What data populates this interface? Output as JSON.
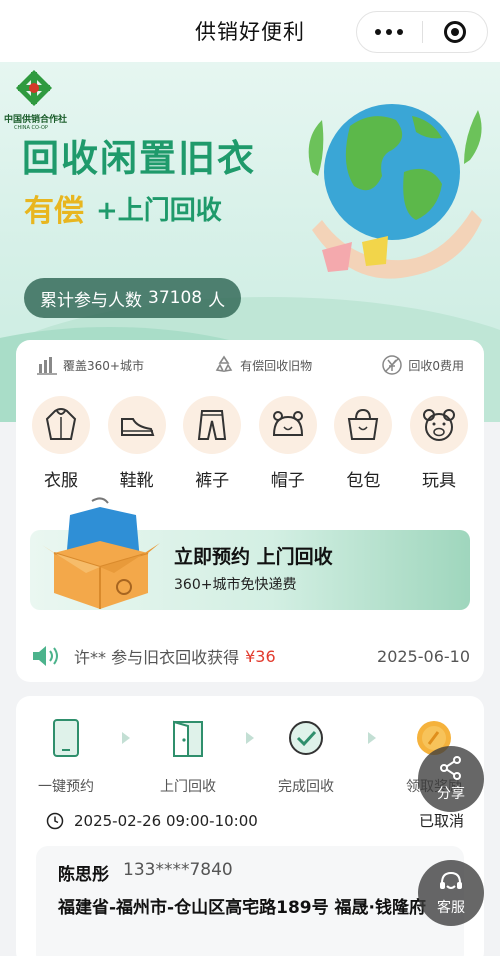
{
  "nav": {
    "title": "供销好便利"
  },
  "banner": {
    "logo_cn": "中国供销合作社",
    "logo_en": "CHINA CO-OP",
    "headline": "回收闲置旧衣",
    "paid": "有偿",
    "door": "+上门回收",
    "participants_label": "累计参与人数",
    "participants_count": "37108",
    "participants_unit": "人"
  },
  "features": [
    {
      "icon": "chart-bars-icon",
      "label": "覆盖360+城市"
    },
    {
      "icon": "recycle-icon",
      "label": "有偿回收旧物"
    },
    {
      "icon": "yuan-free-icon",
      "label": "回收0费用"
    }
  ],
  "categories": [
    {
      "icon": "jacket-icon",
      "label": "衣服"
    },
    {
      "icon": "shoe-icon",
      "label": "鞋靴"
    },
    {
      "icon": "pants-icon",
      "label": "裤子"
    },
    {
      "icon": "hat-icon",
      "label": "帽子"
    },
    {
      "icon": "bag-icon",
      "label": "包包"
    },
    {
      "icon": "bear-toy-icon",
      "label": "玩具"
    }
  ],
  "cta": {
    "title": "立即预约 上门回收",
    "subtitle": "360+城市免快递费"
  },
  "ticker": {
    "text": "许** 参与旧衣回收获得",
    "amount": "¥36",
    "date": "2025-06-10"
  },
  "steps": [
    {
      "icon": "phone-icon",
      "label": "一键预约"
    },
    {
      "icon": "door-icon",
      "label": "上门回收"
    },
    {
      "icon": "check-circle-icon",
      "label": "完成回收"
    },
    {
      "icon": "coin-icon",
      "label": "领取奖励"
    }
  ],
  "order": {
    "time": "2025-02-26 09:00-10:00",
    "status": "已取消",
    "name": "陈思彤",
    "phone": "133****7840",
    "address": "福建省-福州市-仓山区高宅路189号 福晟·钱隆府"
  },
  "floating": {
    "share": "分享",
    "service": "客服"
  },
  "colors": {
    "brand_green": "#1f9a6b",
    "accent_yellow": "#e8b61f",
    "price_red": "#e23b2e"
  }
}
